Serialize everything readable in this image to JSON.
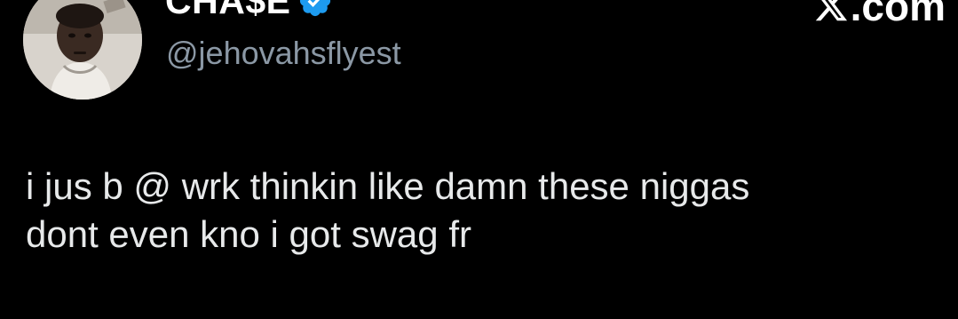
{
  "author": {
    "display_name": "CHA$E",
    "handle": "@jehovahsflyest",
    "verified": true,
    "avatar_icon": "profile-photo",
    "verified_icon": "verified-check-badge-icon",
    "verified_color": "#1d9bf0"
  },
  "brand": {
    "icon": "x-logo-icon",
    "text": ".com"
  },
  "tweet": {
    "lines": [
      "i jus b @ wrk thinkin like damn these niggas",
      "dont even kno i got swag fr"
    ]
  },
  "colors": {
    "background": "#000000",
    "text": "#e7e9ea",
    "handle": "#8b98a5"
  }
}
